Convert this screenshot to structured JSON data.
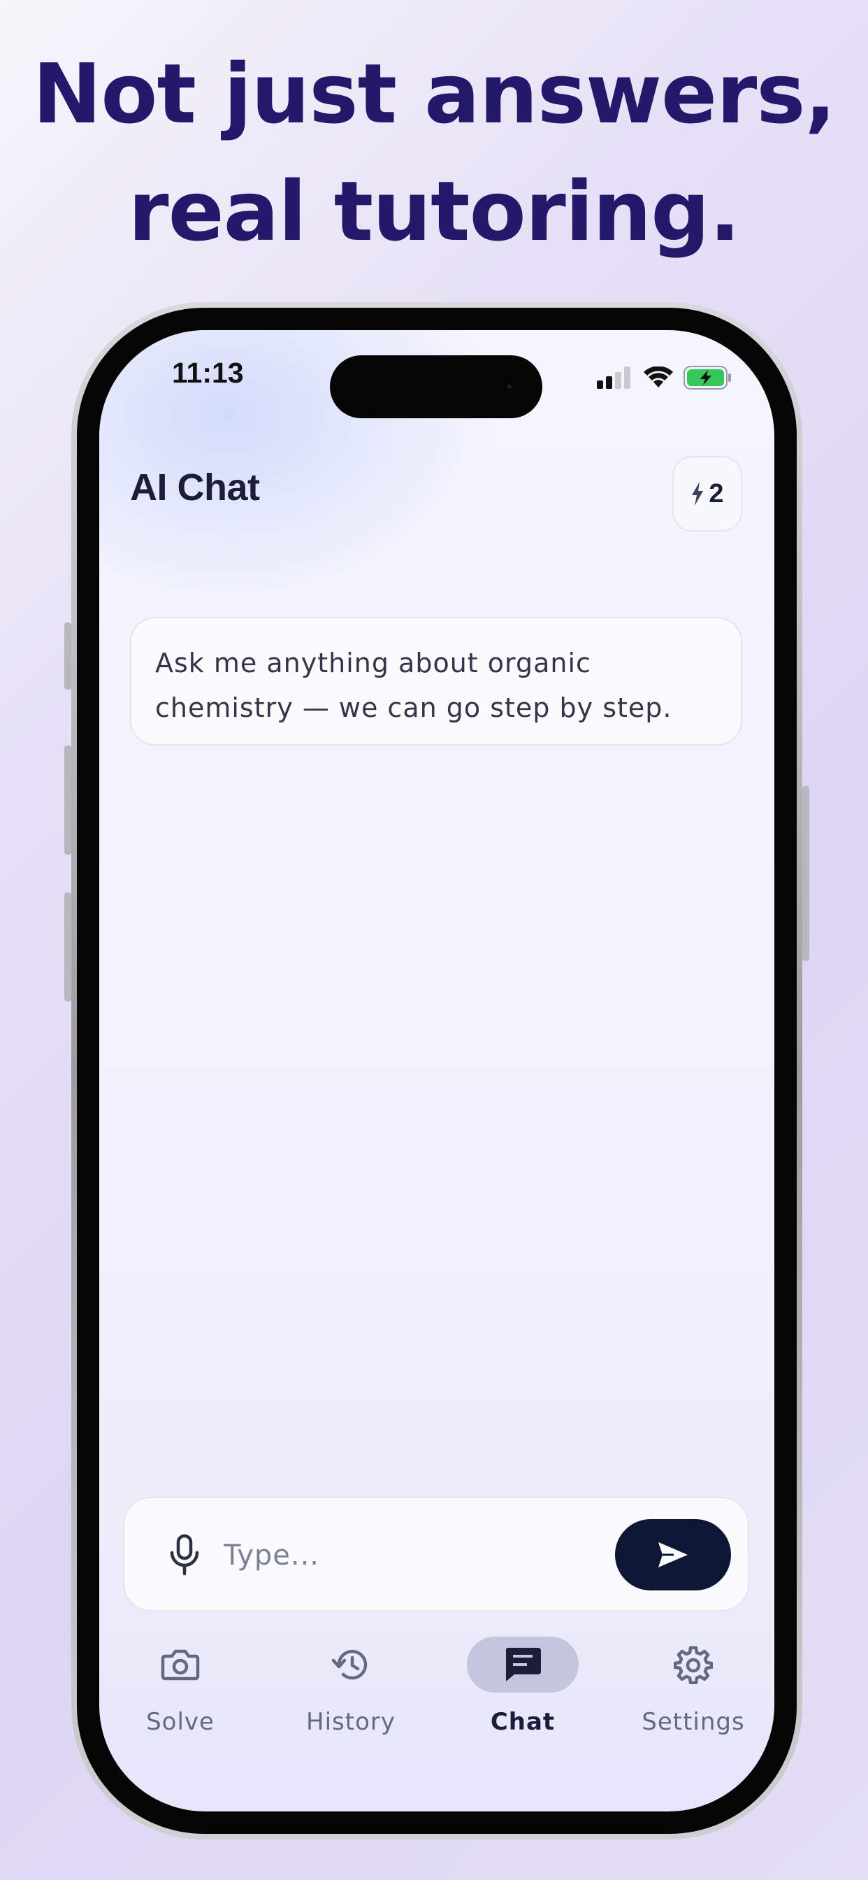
{
  "headline": {
    "line1": "Not just answers,",
    "line2": "real tutoring."
  },
  "status_bar": {
    "time": "11:13",
    "icons": [
      "cellular-signal-icon",
      "wifi-icon",
      "battery-charging-icon"
    ]
  },
  "header": {
    "title": "AI Chat",
    "credits_icon": "bolt-icon",
    "credits_count": "2"
  },
  "chat": {
    "messages": [
      {
        "role": "assistant",
        "text": "Ask me anything about organic chemistry — we can go step by step."
      }
    ]
  },
  "composer": {
    "placeholder": "Type...",
    "value": "",
    "mic_icon": "microphone-icon",
    "send_icon": "send-icon"
  },
  "tabbar": {
    "tabs": [
      {
        "label": "Solve",
        "icon": "camera-icon",
        "active": false
      },
      {
        "label": "History",
        "icon": "history-icon",
        "active": false
      },
      {
        "label": "Chat",
        "icon": "chat-bubble-icon",
        "active": true
      },
      {
        "label": "Settings",
        "icon": "gear-icon",
        "active": false
      }
    ]
  },
  "colors": {
    "headline": "#24186a",
    "send_button": "#0b1733",
    "active_tab_pill": "#c4c6de",
    "battery_fill": "#34c759"
  }
}
